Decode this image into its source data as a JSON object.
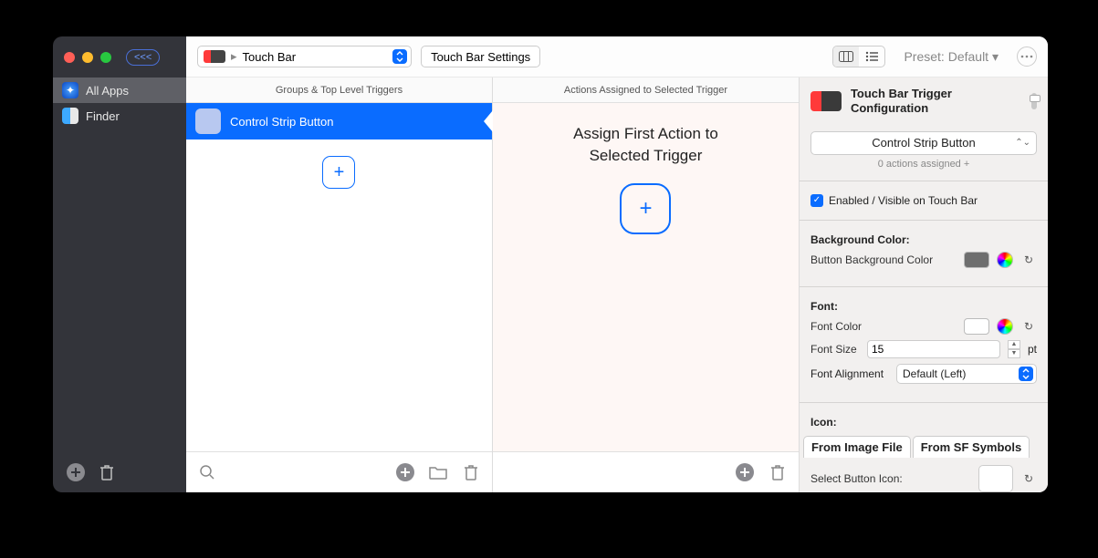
{
  "sidebar": {
    "badge": "<<<",
    "items": [
      {
        "label": "All Apps"
      },
      {
        "label": "Finder"
      }
    ]
  },
  "toolbar": {
    "scope": "Touch Bar",
    "settings_button": "Touch Bar Settings",
    "preset_label": "Preset: Default ▾"
  },
  "columns": {
    "groups_header": "Groups & Top Level Triggers",
    "actions_header": "Actions Assigned to Selected Trigger",
    "trigger_name": "Control Strip Button",
    "assign_line1": "Assign First Action to",
    "assign_line2": "Selected Trigger"
  },
  "inspector": {
    "title": "Touch Bar Trigger Configuration",
    "type_dropdown": "Control Strip Button",
    "actions_assigned": "0 actions assigned +",
    "enabled_label": "Enabled / Visible on Touch Bar",
    "bg_section": "Background Color:",
    "bg_label": "Button Background Color",
    "font_section": "Font:",
    "font_color_label": "Font Color",
    "font_size_label": "Font Size",
    "font_size_value": "15",
    "font_size_unit": "pt",
    "font_align_label": "Font Alignment",
    "font_align_value": "Default (Left)",
    "icon_section": "Icon:",
    "tab_image": "From Image File",
    "tab_sf": "From SF Symbols",
    "select_icon_label": "Select Button Icon:"
  },
  "colors": {
    "button_bg": "#6e6e6e",
    "font_color": "#ffffff"
  }
}
